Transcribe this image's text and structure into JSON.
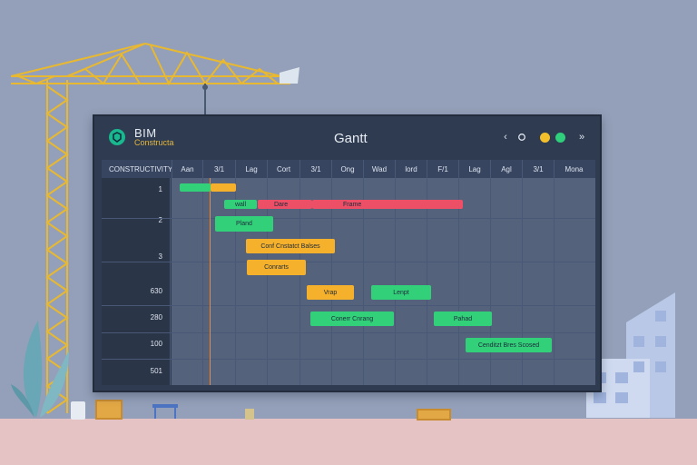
{
  "app": {
    "brand": "BIM",
    "brand_sub": "Constructa",
    "title": "Gantt"
  },
  "header_icons": [
    "chevron-left-icon",
    "settings-icon",
    "status-yellow-icon",
    "status-green-icon",
    "chevrons-right-icon"
  ],
  "table": {
    "first_column_header": "CONSTRUCTIVITY",
    "columns": [
      "Aan",
      "3/1",
      "Lag",
      "Cort",
      "3/1",
      "Ong",
      "Wad",
      "lord",
      "F/1",
      "Lag",
      "Agl",
      "3/1",
      "Mona"
    ],
    "rows": [
      "1",
      "2",
      "3",
      "630",
      "280",
      "100",
      "501"
    ]
  },
  "tasks": [
    {
      "label": "",
      "color": "green"
    },
    {
      "label": "",
      "color": "orange"
    },
    {
      "label": "wall",
      "color": "green"
    },
    {
      "label": "Dare",
      "color": "red"
    },
    {
      "label": "Frame",
      "color": "red"
    },
    {
      "label": "Pland",
      "color": "green"
    },
    {
      "label": "Conf Cnstatct Balses",
      "color": "orange"
    },
    {
      "label": "Conrarts",
      "color": "orange"
    },
    {
      "label": "Vrap",
      "color": "orange"
    },
    {
      "label": "Lenpt",
      "color": "green"
    },
    {
      "label": "Conerr Cnrang",
      "color": "green"
    },
    {
      "label": "Pahad",
      "color": "green"
    },
    {
      "label": "Cenditzt Bres Scosed",
      "color": "green"
    }
  ],
  "colors": {
    "green": "#33d07a",
    "orange": "#f6b12c",
    "red": "#ec4f66",
    "today_marker": "#e68b3c"
  }
}
